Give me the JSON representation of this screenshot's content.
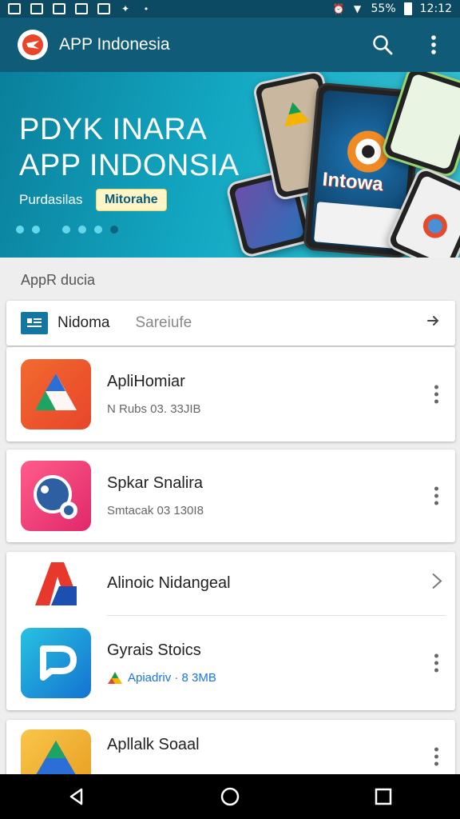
{
  "status_bar": {
    "battery": "55%",
    "time": "12:12"
  },
  "app_bar": {
    "title": "APP Indonesia",
    "icons": [
      "logo-icon",
      "search-icon",
      "more-vert-icon"
    ]
  },
  "hero": {
    "title_line1": "PDYK INARA",
    "title_line2": "APP INDONSIA",
    "subtitle": "Purdasilas",
    "chip": "Mitorahe",
    "phone_text": "Intowa",
    "dots_count": 6,
    "active_dot": 6
  },
  "section": {
    "label": "AppR ducia"
  },
  "tabs": {
    "primary": "Nidoma",
    "secondary": "Sareiufe"
  },
  "apps": [
    {
      "name": "ApliHomiar",
      "meta": "N Rubs 03. 33JIB",
      "icon": "drive-like-icon"
    },
    {
      "name": "Spkar Snalira",
      "meta": "Smtacak 03 130I8",
      "icon": "chat-bubble-icon"
    },
    {
      "name": "Alinoic Nidangeal",
      "meta": "",
      "icon": "alpha-logo-icon"
    },
    {
      "name": "Gyrais Stoics",
      "meta": "Apiadriv · 8 3MB",
      "icon": "p-logo-icon"
    },
    {
      "name": "Apllalk Soaal",
      "meta": "",
      "icon": "triangle-app-icon"
    }
  ],
  "colors": {
    "app_bar": "#0f5b78",
    "accent": "#1276a0",
    "background": "#eeeeee"
  },
  "nav_bar": {
    "buttons": [
      "back-icon",
      "home-icon",
      "recents-icon"
    ]
  }
}
